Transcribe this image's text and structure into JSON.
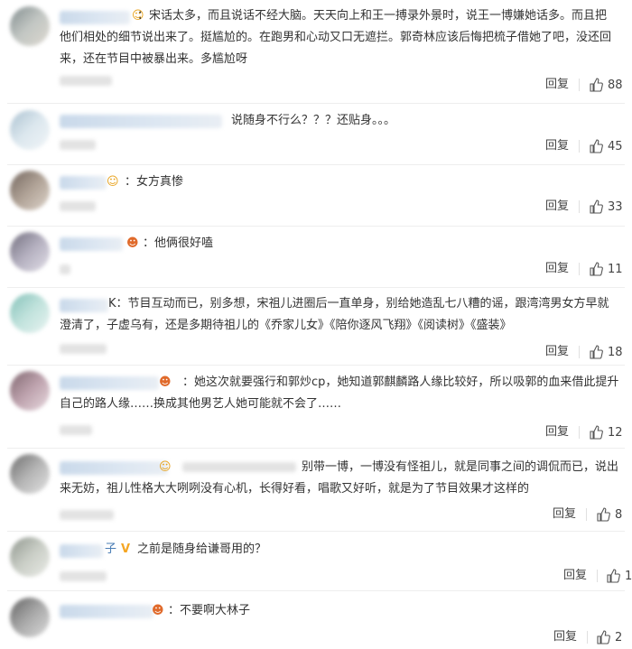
{
  "colors": {
    "reply": "#444444",
    "text": "#333333",
    "name_blur": "#c9d9ea",
    "divider": "#eeeeee"
  },
  "actions": {
    "reply_label": "回复",
    "like_icon": "thumbs-up-icon"
  },
  "comments": [
    {
      "suffix": "：",
      "text": "宋话太多，而且说话不经大脑。天天向上和王一搏录外景时，说王一博嫌她话多。而且把他们相处的细节说出来了。挺尴尬的。在跑男和心动又口无遮拦。郭奇林应该后悔把梳子借她了吧，没还回来，还在节目中被暴出来。多尴尬呀",
      "likes": "88"
    },
    {
      "suffix": "",
      "text": "说随身不行么？？？还贴身。。。",
      "likes": "45"
    },
    {
      "suffix": "：",
      "text": "女方真惨",
      "likes": "33"
    },
    {
      "suffix": "：",
      "text": "他俩很好嗑",
      "likes": "11"
    },
    {
      "suffix": "K：",
      "text": "节目互动而已，别多想，宋祖儿进圈后一直单身，别给她造乱七八糟的谣，跟湾湾男女方早就澄清了，子虚乌有，还是多期待祖儿的《乔家儿女》《陪你逐风飞翔》《阅读树》《盛装》",
      "likes": "18"
    },
    {
      "suffix": "：",
      "text": "她这次就要强行和郭炒cp，她知道郭麒麟路人缘比较好，所以吸郭的血来借此提升自己的路人缘……换成其他男艺人她可能就不会了……",
      "likes": "12"
    },
    {
      "suffix": "",
      "text": "别带一博，一博没有怪祖儿，就是同事之间的调侃而已，说出来无妨，祖儿性格大大咧咧没有心机，长得好看，唱歌又好听，就是为了节目效果才这样的",
      "likes": "8"
    },
    {
      "suffix": "子",
      "text": "之前是随身给谦哥用的？",
      "likes": "1"
    },
    {
      "suffix": "：",
      "text": "不要啊大林子",
      "likes": "2"
    }
  ]
}
